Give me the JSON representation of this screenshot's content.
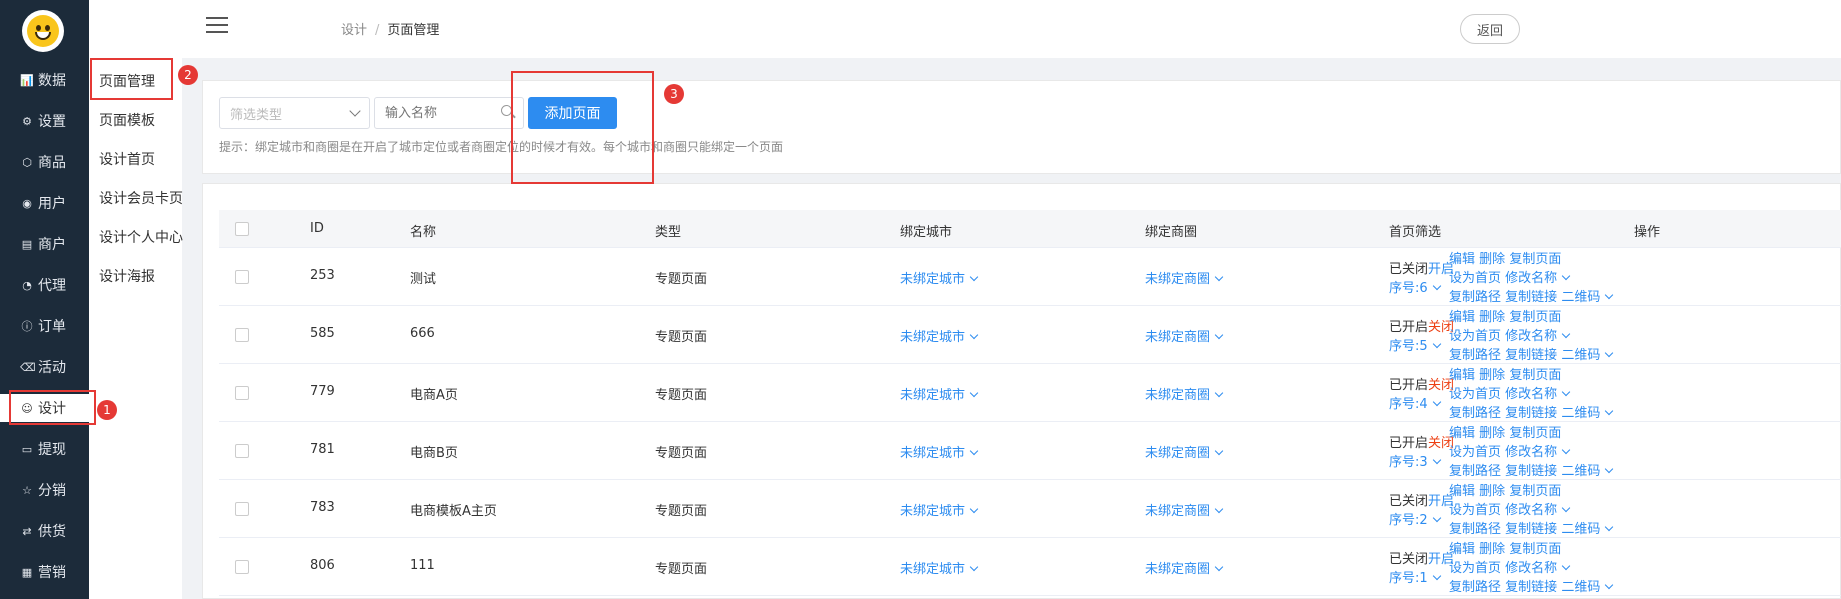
{
  "sidebar": {
    "items": [
      {
        "icon": "bar-chart-icon",
        "glyph": "📊",
        "label": "数据"
      },
      {
        "icon": "gear-icon",
        "glyph": "⚙",
        "label": "设置"
      },
      {
        "icon": "box-icon",
        "glyph": "⬡",
        "label": "商品"
      },
      {
        "icon": "user-icon",
        "glyph": "◉",
        "label": "用户"
      },
      {
        "icon": "store-icon",
        "glyph": "▤",
        "label": "商户"
      },
      {
        "icon": "agent-icon",
        "glyph": "◔",
        "label": "代理"
      },
      {
        "icon": "order-icon",
        "glyph": "ⓘ",
        "label": "订单"
      },
      {
        "icon": "tag-icon",
        "glyph": "⌫",
        "label": "活动"
      },
      {
        "icon": "design-icon",
        "glyph": "☺",
        "label": "设计"
      },
      {
        "icon": "card-icon",
        "glyph": "▭",
        "label": "提现"
      },
      {
        "icon": "star-icon",
        "glyph": "☆",
        "label": "分销"
      },
      {
        "icon": "exchange-icon",
        "glyph": "⇄",
        "label": "供货"
      },
      {
        "icon": "grid-icon",
        "glyph": "▦",
        "label": "营销"
      }
    ]
  },
  "submenu": {
    "items": [
      "页面管理",
      "页面模板",
      "设计首页",
      "设计会员卡页",
      "设计个人中心",
      "设计海报"
    ]
  },
  "header": {
    "breadcrumb_parent": "设计",
    "breadcrumb_sep": "/",
    "breadcrumb_current": "页面管理",
    "back_label": "返回"
  },
  "filter": {
    "type_placeholder": "筛选类型",
    "search_placeholder": "输入名称",
    "add_label": "添加页面",
    "tip": "提示：绑定城市和商圈是在开启了城市定位或者商圈定位的时候才有效。每个城市和商圈只能绑定一个页面"
  },
  "table": {
    "headers": [
      "ID",
      "名称",
      "类型",
      "绑定城市",
      "绑定商圈",
      "首页筛选",
      "操作"
    ],
    "rows": [
      {
        "id": "253",
        "name": "测试",
        "type": "专题页面",
        "city": "未绑定城市",
        "district": "未绑定商圈",
        "status": "已关闭",
        "toggle": "开启",
        "toggle_color": "blue",
        "order": "序号:6"
      },
      {
        "id": "585",
        "name": "666",
        "type": "专题页面",
        "city": "未绑定城市",
        "district": "未绑定商圈",
        "status": "已开启",
        "toggle": "关闭",
        "toggle_color": "red",
        "order": "序号:5"
      },
      {
        "id": "779",
        "name": "电商A页",
        "type": "专题页面",
        "city": "未绑定城市",
        "district": "未绑定商圈",
        "status": "已开启",
        "toggle": "关闭",
        "toggle_color": "red",
        "order": "序号:4"
      },
      {
        "id": "781",
        "name": "电商B页",
        "type": "专题页面",
        "city": "未绑定城市",
        "district": "未绑定商圈",
        "status": "已开启",
        "toggle": "关闭",
        "toggle_color": "red",
        "order": "序号:3"
      },
      {
        "id": "783",
        "name": "电商模板A主页",
        "type": "专题页面",
        "city": "未绑定城市",
        "district": "未绑定商圈",
        "status": "已关闭",
        "toggle": "开启",
        "toggle_color": "blue",
        "order": "序号:2"
      },
      {
        "id": "806",
        "name": "111",
        "type": "专题页面",
        "city": "未绑定城市",
        "district": "未绑定商圈",
        "status": "已关闭",
        "toggle": "开启",
        "toggle_color": "blue",
        "order": "序号:1"
      }
    ],
    "ops": {
      "edit": "编辑",
      "delete": "删除",
      "copy_page": "复制页面",
      "set_home": "设为首页",
      "rename": "修改名称",
      "copy_path": "复制路径",
      "copy_link": "复制链接",
      "qrcode": "二维码"
    }
  },
  "annotations": [
    "1",
    "2",
    "3"
  ],
  "colors": {
    "sidebar_bg": "#1c2b3a",
    "primary": "#2d8cf0",
    "danger": "#ed4014",
    "annotation": "#e53935"
  }
}
